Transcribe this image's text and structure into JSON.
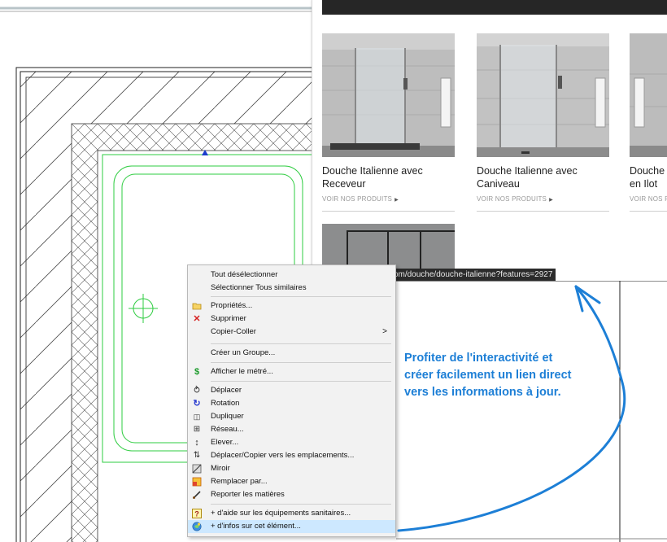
{
  "browser": {
    "products": [
      {
        "title_line1": "Douche Italienne avec",
        "title_line2": "Receveur",
        "link": "VOIR NOS PRODUITS"
      },
      {
        "title_line1": "Douche Italienne avec",
        "title_line2": "Caniveau",
        "link": "VOIR NOS PRODUITS"
      },
      {
        "title_line1": "Douche",
        "title_line2": "en Ilot",
        "link": "VOIR NOS PI"
      }
    ],
    "status_url": "https://fr.hudsonreed.com/douche/douche-italienne?features=2927"
  },
  "context_menu": {
    "items": [
      {
        "label": "Tout désélectionner",
        "icon": ""
      },
      {
        "label": "Sélectionner Tous similaires",
        "icon": ""
      },
      {
        "label": "Propriétés...",
        "icon": "folder-icon"
      },
      {
        "label": "Supprimer",
        "icon": "delete-x-icon"
      },
      {
        "label": "Copier-Coller",
        "icon": "",
        "submenu": ">"
      },
      {
        "label": "Créer un Groupe...",
        "icon": ""
      },
      {
        "label": "Afficher le métré...",
        "icon": "dollar-icon"
      },
      {
        "label": "Déplacer",
        "icon": "move-icon"
      },
      {
        "label": "Rotation",
        "icon": "rotation-icon"
      },
      {
        "label": "Dupliquer",
        "icon": "duplicate-icon"
      },
      {
        "label": "Réseau...",
        "icon": "array-icon"
      },
      {
        "label": "Elever...",
        "icon": "elevate-icon"
      },
      {
        "label": "Déplacer/Copier vers les emplacements...",
        "icon": "move-copy-icon"
      },
      {
        "label": "Miroir",
        "icon": "mirror-icon"
      },
      {
        "label": "Remplacer par...",
        "icon": "replace-icon"
      },
      {
        "label": "Reporter les matières",
        "icon": "brush-icon"
      },
      {
        "label": "+ d'aide sur les équipements sanitaires...",
        "icon": "help-icon"
      },
      {
        "label": "+ d'infos sur cet élément...",
        "icon": "info-icon",
        "highlighted": true
      }
    ]
  },
  "callout": {
    "line1": "Profiter de l'interactivité et",
    "line2": "créer facilement un lien direct",
    "line3": "vers les informations à jour."
  },
  "colors": {
    "callout_blue": "#1d7fd6",
    "selection_green": "#2ecc40",
    "menu_highlight": "#cde8ff"
  }
}
